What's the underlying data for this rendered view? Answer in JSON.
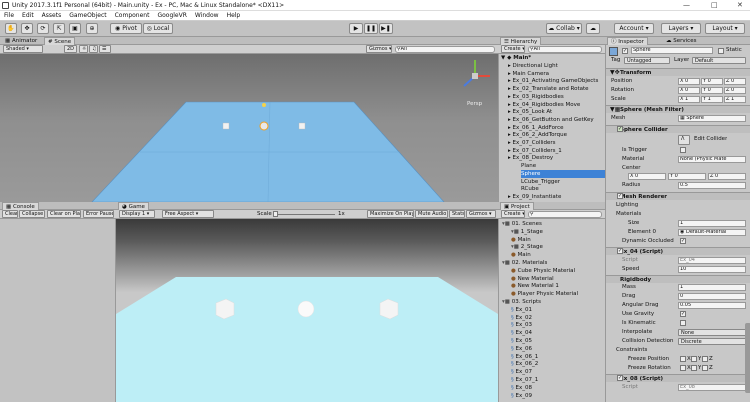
{
  "window": {
    "title": "Unity 2017.3.1f1 Personal (64bit) - Main.unity - Ex - PC, Mac & Linux Standalone* <DX11>"
  },
  "menu": [
    "File",
    "Edit",
    "Assets",
    "GameObject",
    "Component",
    "GoogleVR",
    "Window",
    "Help"
  ],
  "toolbar": {
    "pivot": "Pivot",
    "local": "Local",
    "collab": "Collab",
    "account": "Account",
    "layers": "Layers",
    "layout": "Layout"
  },
  "scene_tabs": {
    "animator": "Animator",
    "scene": "Scene"
  },
  "scene_bar": {
    "shaded": "Shaded",
    "mode2d": "2D",
    "gizmos": "Gizmos",
    "search": "All",
    "persp": "Persp"
  },
  "hierarchy": {
    "tab": "Hierarchy",
    "create": "Create",
    "search": "All",
    "scene": "Main*",
    "items": [
      {
        "label": "Directional Light",
        "indent": 0
      },
      {
        "label": "Main Camera",
        "indent": 0
      },
      {
        "label": "Ex_01_Activating GameObjects",
        "indent": 0
      },
      {
        "label": "Ex_02_Translate and Rotate",
        "indent": 0
      },
      {
        "label": "Ex_03_Rigidbodies",
        "indent": 0
      },
      {
        "label": "Ex_04_Rigidbodies Move",
        "indent": 0
      },
      {
        "label": "Ex_05_Look At",
        "indent": 0
      },
      {
        "label": "Ex_06_GetButton and GetKey",
        "indent": 0
      },
      {
        "label": "Ex_06_1_AddForce",
        "indent": 0
      },
      {
        "label": "Ex_06_2_AddTorque",
        "indent": 0
      },
      {
        "label": "Ex_07_Colliders",
        "indent": 0
      },
      {
        "label": "Ex_07_Colliders_1",
        "indent": 0
      },
      {
        "label": "Ex_08_Destroy",
        "indent": 0
      },
      {
        "label": "Plane",
        "indent": 1
      },
      {
        "label": "Sphere",
        "indent": 1
      },
      {
        "label": "LCube_Trigger",
        "indent": 1
      },
      {
        "label": "RCube",
        "indent": 1
      },
      {
        "label": "Ex_09_Instantiate",
        "indent": 0
      }
    ]
  },
  "console": {
    "tab": "Console",
    "buttons": [
      "Clear",
      "Collapse",
      "Clear on Play",
      "Error Pause"
    ]
  },
  "game": {
    "tab": "Game",
    "display": "Display 1",
    "aspect": "Free Aspect",
    "scale_label": "Scale",
    "scale_value": "1x",
    "maximize": "Maximize On Play",
    "mute": "Mute Audio",
    "stats": "Stats",
    "gizmos": "Gizmos"
  },
  "project": {
    "tab": "Project",
    "create": "Create",
    "items": [
      {
        "label": "01. Scenes",
        "indent": 0
      },
      {
        "label": "1_Stage",
        "indent": 1
      },
      {
        "label": "Main",
        "indent": 1
      },
      {
        "label": "2_Stage",
        "indent": 1
      },
      {
        "label": "Main",
        "indent": 1
      },
      {
        "label": "02. Materials",
        "indent": 0
      },
      {
        "label": "Cube Physic Material",
        "indent": 1
      },
      {
        "label": "New Material",
        "indent": 1
      },
      {
        "label": "New Material 1",
        "indent": 1
      },
      {
        "label": "Player Physic Material",
        "indent": 1
      },
      {
        "label": "03. Scripts",
        "indent": 0
      },
      {
        "label": "Ex_01",
        "indent": 1
      },
      {
        "label": "Ex_02",
        "indent": 1
      },
      {
        "label": "Ex_03",
        "indent": 1
      },
      {
        "label": "Ex_04",
        "indent": 1
      },
      {
        "label": "Ex_05",
        "indent": 1
      },
      {
        "label": "Ex_06",
        "indent": 1
      },
      {
        "label": "Ex_06_1",
        "indent": 1
      },
      {
        "label": "Ex_06_2",
        "indent": 1
      },
      {
        "label": "Ex_07",
        "indent": 1
      },
      {
        "label": "Ex_07_1",
        "indent": 1
      },
      {
        "label": "Ex_08",
        "indent": 1
      },
      {
        "label": "Ex_09",
        "indent": 1
      }
    ]
  },
  "inspector": {
    "tab": "Inspector",
    "services": "Services",
    "object_name": "Sphere",
    "static_label": "Static",
    "tag_label": "Tag",
    "tag": "Untagged",
    "layer_label": "Layer",
    "layer": "Default",
    "transform": {
      "header": "Transform",
      "position": "Position",
      "rotation": "Rotation",
      "scale": "Scale",
      "pos": [
        "X 0",
        "Y 0",
        "Z 0"
      ],
      "rot": [
        "X 0",
        "Y 0",
        "Z 0"
      ],
      "scl": [
        "X 1",
        "Y 1",
        "Z 1"
      ]
    },
    "mesh_filter": {
      "header": "Sphere (Mesh Filter)",
      "mesh_label": "Mesh",
      "mesh": "Sphere"
    },
    "collider": {
      "header": "Sphere Collider",
      "edit": "Edit Collider",
      "is_trigger": "Is Trigger",
      "material_label": "Material",
      "material": "None (Physic Mate",
      "center_label": "Center",
      "center": [
        "X 0",
        "Y 0",
        "Z 0"
      ],
      "radius_label": "Radius",
      "radius": "0.5"
    },
    "renderer": {
      "header": "Mesh Renderer",
      "lighting": "Lighting",
      "materials": "Materials",
      "size_label": "Size",
      "size": "1",
      "element0_label": "Element 0",
      "element0": "Default-Material",
      "dyn_occ": "Dynamic Occluded"
    },
    "script4": {
      "header": "Ex_04 (Script)",
      "script_label": "Script",
      "script": "Ex_04",
      "speed_label": "Speed",
      "speed": "10"
    },
    "rigidbody": {
      "header": "Rigidbody",
      "mass_label": "Mass",
      "mass": "1",
      "drag_label": "Drag",
      "drag": "0",
      "adrag_label": "Angular Drag",
      "adrag": "0.05",
      "gravity": "Use Gravity",
      "kinematic": "Is Kinematic",
      "interp_label": "Interpolate",
      "interp": "None",
      "coll_label": "Collision Detection",
      "coll": "Discrete",
      "constraints": "Constraints",
      "freeze_pos": "Freeze Position",
      "freeze_rot": "Freeze Rotation",
      "axes": [
        "X",
        "Y",
        "Z"
      ]
    },
    "script8": {
      "header": "Ex_08 (Script)",
      "script_label": "Script",
      "script": "Ex_08"
    }
  }
}
